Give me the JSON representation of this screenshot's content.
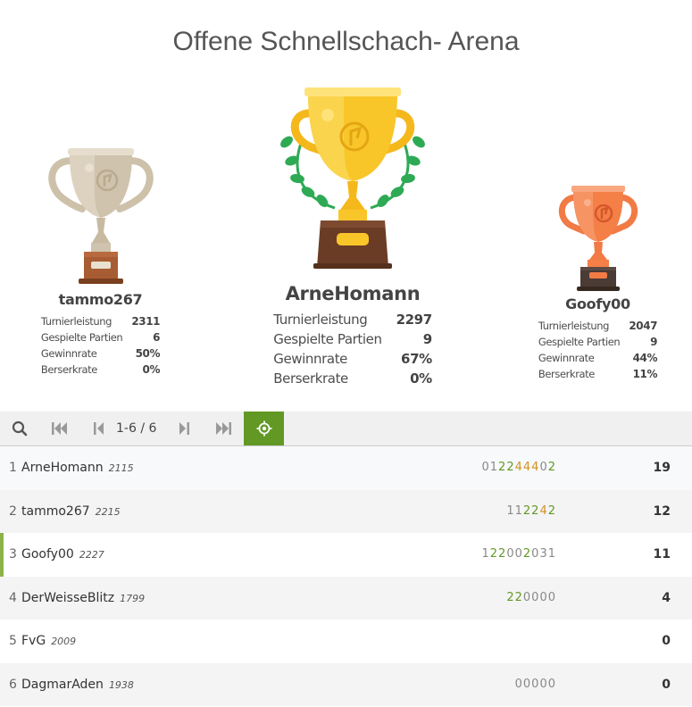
{
  "title": "Offene Schnellschach- Arena",
  "podium": {
    "first": {
      "name": "ArneHomann",
      "stats": [
        {
          "label": "Turnierleistung",
          "value": "2297"
        },
        {
          "label": "Gespielte Partien",
          "value": "9"
        },
        {
          "label": "Gewinnrate",
          "value": "67%"
        },
        {
          "label": "Berserkrate",
          "value": "0%"
        }
      ]
    },
    "second": {
      "name": "tammo267",
      "stats": [
        {
          "label": "Turnierleistung",
          "value": "2311"
        },
        {
          "label": "Gespielte Partien",
          "value": "6"
        },
        {
          "label": "Gewinnrate",
          "value": "50%"
        },
        {
          "label": "Berserkrate",
          "value": "0%"
        }
      ]
    },
    "third": {
      "name": "Goofy00",
      "stats": [
        {
          "label": "Turnierleistung",
          "value": "2047"
        },
        {
          "label": "Gespielte Partien",
          "value": "9"
        },
        {
          "label": "Gewinnrate",
          "value": "44%"
        },
        {
          "label": "Berserkrate",
          "value": "11%"
        }
      ]
    }
  },
  "pager": {
    "page_info": "1-6 / 6",
    "icons": [
      "search-icon",
      "first-page-icon",
      "prev-page-icon",
      "next-page-icon",
      "last-page-icon",
      "focus-icon"
    ]
  },
  "colors": {
    "accent": "#629924",
    "win": "#629924",
    "streak": "#d59020",
    "gold": "#f5c026",
    "silver": "#cfc3ad",
    "bronze": "#f27a45"
  },
  "standings": [
    {
      "rank": "1",
      "name": "ArneHomann",
      "rating": "2115",
      "sheet": "012244402",
      "total": "19"
    },
    {
      "rank": "2",
      "name": "tammo267",
      "rating": "2215",
      "sheet": "112242",
      "total": "12"
    },
    {
      "rank": "3",
      "name": "Goofy00",
      "rating": "2227",
      "sheet": "122002031",
      "total": "11"
    },
    {
      "rank": "4",
      "name": "DerWeisseBlitz",
      "rating": "1799",
      "sheet": "220000",
      "total": "4"
    },
    {
      "rank": "5",
      "name": "FvG",
      "rating": "2009",
      "sheet": "",
      "total": "0"
    },
    {
      "rank": "6",
      "name": "DagmarAden",
      "rating": "1938",
      "sheet": "00000",
      "total": "0"
    }
  ]
}
